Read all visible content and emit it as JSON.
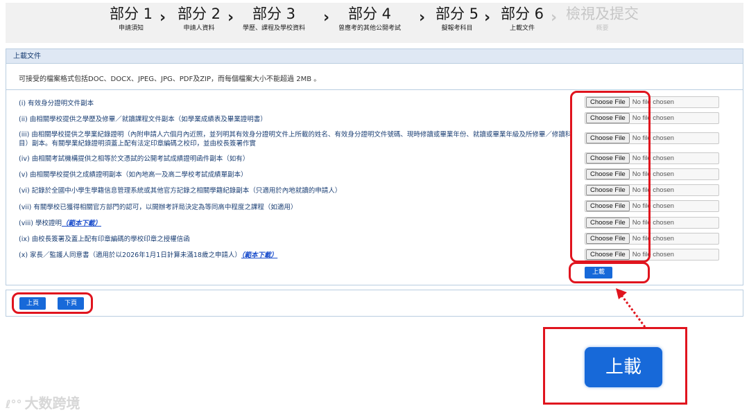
{
  "stepper": {
    "steps": [
      {
        "title": "部分 1",
        "sub": "申請須知"
      },
      {
        "title": "部分 2",
        "sub": "申請人資料"
      },
      {
        "title": "部分 3",
        "sub": "學歷、課程及學校資料"
      },
      {
        "title": "部分 4",
        "sub": "曾應考的其他公開考試"
      },
      {
        "title": "部分 5",
        "sub": "擬報考科目"
      },
      {
        "title": "部分 6",
        "sub": "上載文件"
      },
      {
        "title": "檢視及提交",
        "sub": "概要"
      }
    ],
    "chevron": "›"
  },
  "upload": {
    "header": "上載文件",
    "note": "可接受的檔案格式包括DOC、DOCX、JPEG、JPG、PDF及ZIP，而每個檔案大小不能超過 2MB 。",
    "choose_label": "Choose File",
    "no_file": "No file chosen",
    "items": [
      {
        "text": "(i) 有效身分證明文件副本",
        "link": ""
      },
      {
        "text": "(ii) 由相關學校提供之學歷及修畢／就讀課程文件副本（如學業成績表及畢業證明書）",
        "link": ""
      },
      {
        "text": "(iii) 由相關學校提供之學業紀錄證明（內附申請人六個月內近照，並列明其有效身分證明文件上所載的姓名、有效身分證明文件號碼、現時修讀或畢業年份、就讀或畢業年級及所修畢／修讀科目）副本。有關學業紀錄證明須蓋上配有法定印章編碼之校印，並由校長簽署作實",
        "link": ""
      },
      {
        "text": "(iv) 由相關考試機構提供之相等於文憑試的公開考試成績證明函件副本（如有）",
        "link": ""
      },
      {
        "text": "(v) 由相關學校提供之成績證明副本（如內地高一及高二學校考試成績單副本）",
        "link": ""
      },
      {
        "text": "(vi) 記錄於全國中小學生學籍信息管理系統或其他官方記錄之相關學籍紀錄副本（只適用於內地就讀的申請人）",
        "link": ""
      },
      {
        "text": "(vii) 有關學校已獲得相關官方部門的認可，以開辦考評局決定為等同高中程度之課程（如適用）",
        "link": ""
      },
      {
        "text": "(viii) 學校證明",
        "link": "（範本下載）"
      },
      {
        "text": "(ix) 由校長簽署及蓋上配有印章編碼的學校印章之授權信函",
        "link": ""
      },
      {
        "text": "(x) 家長／監護人同意書（適用於以2026年1月1日計算未滿18歲之申請人）",
        "link": "（範本下載）"
      }
    ],
    "upload_button": "上載"
  },
  "nav": {
    "prev": "上頁",
    "next": "下頁"
  },
  "zoom": {
    "button": "上載"
  },
  "watermark": {
    "logo": "ℓ°°",
    "text": "大数跨境"
  },
  "colors": {
    "primary": "#1769d9",
    "highlight": "#e0141e",
    "header_bg": "#dfe8f4",
    "label_text": "#1b3f74"
  }
}
